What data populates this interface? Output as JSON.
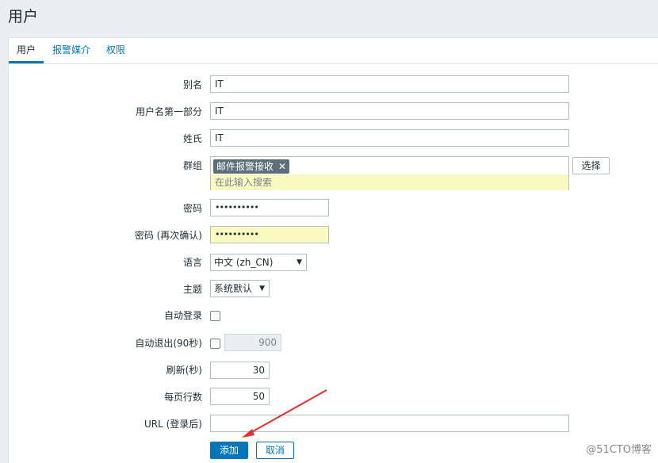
{
  "page": {
    "title": "用户"
  },
  "tabs": [
    {
      "label": "用户",
      "active": true
    },
    {
      "label": "报警媒介",
      "active": false
    },
    {
      "label": "权限",
      "active": false
    }
  ],
  "form": {
    "alias": {
      "label": "别名",
      "value": "IT"
    },
    "name": {
      "label": "用户名第一部分",
      "value": "IT"
    },
    "surname": {
      "label": "姓氏",
      "value": "IT"
    },
    "groups": {
      "label": "群组",
      "selected": [
        "邮件报警接收"
      ],
      "remove_glyph": "✕",
      "search_placeholder": "在此输入搜索",
      "select_button": "选择"
    },
    "password": {
      "label": "密码",
      "value": "••••••••••"
    },
    "password_confirm": {
      "label": "密码 (再次确认)",
      "value": "••••••••••"
    },
    "language": {
      "label": "语言",
      "value": "中文 (zh_CN)"
    },
    "theme": {
      "label": "主题",
      "value": "系统默认"
    },
    "autologin": {
      "label": "自动登录",
      "checked": false
    },
    "autologout": {
      "label": "自动退出(90秒)",
      "checked": false,
      "value": "900"
    },
    "refresh": {
      "label": "刷新(秒)",
      "value": "30"
    },
    "rows_per_page": {
      "label": "每页行数",
      "value": "50"
    },
    "url": {
      "label": "URL (登录后)",
      "value": ""
    }
  },
  "buttons": {
    "add": "添加",
    "cancel": "取消"
  },
  "watermark": "@51CTO博客",
  "colors": {
    "accent": "#0275b8",
    "highlight": "#fafac0",
    "annotation_arrow": "#e03030"
  }
}
